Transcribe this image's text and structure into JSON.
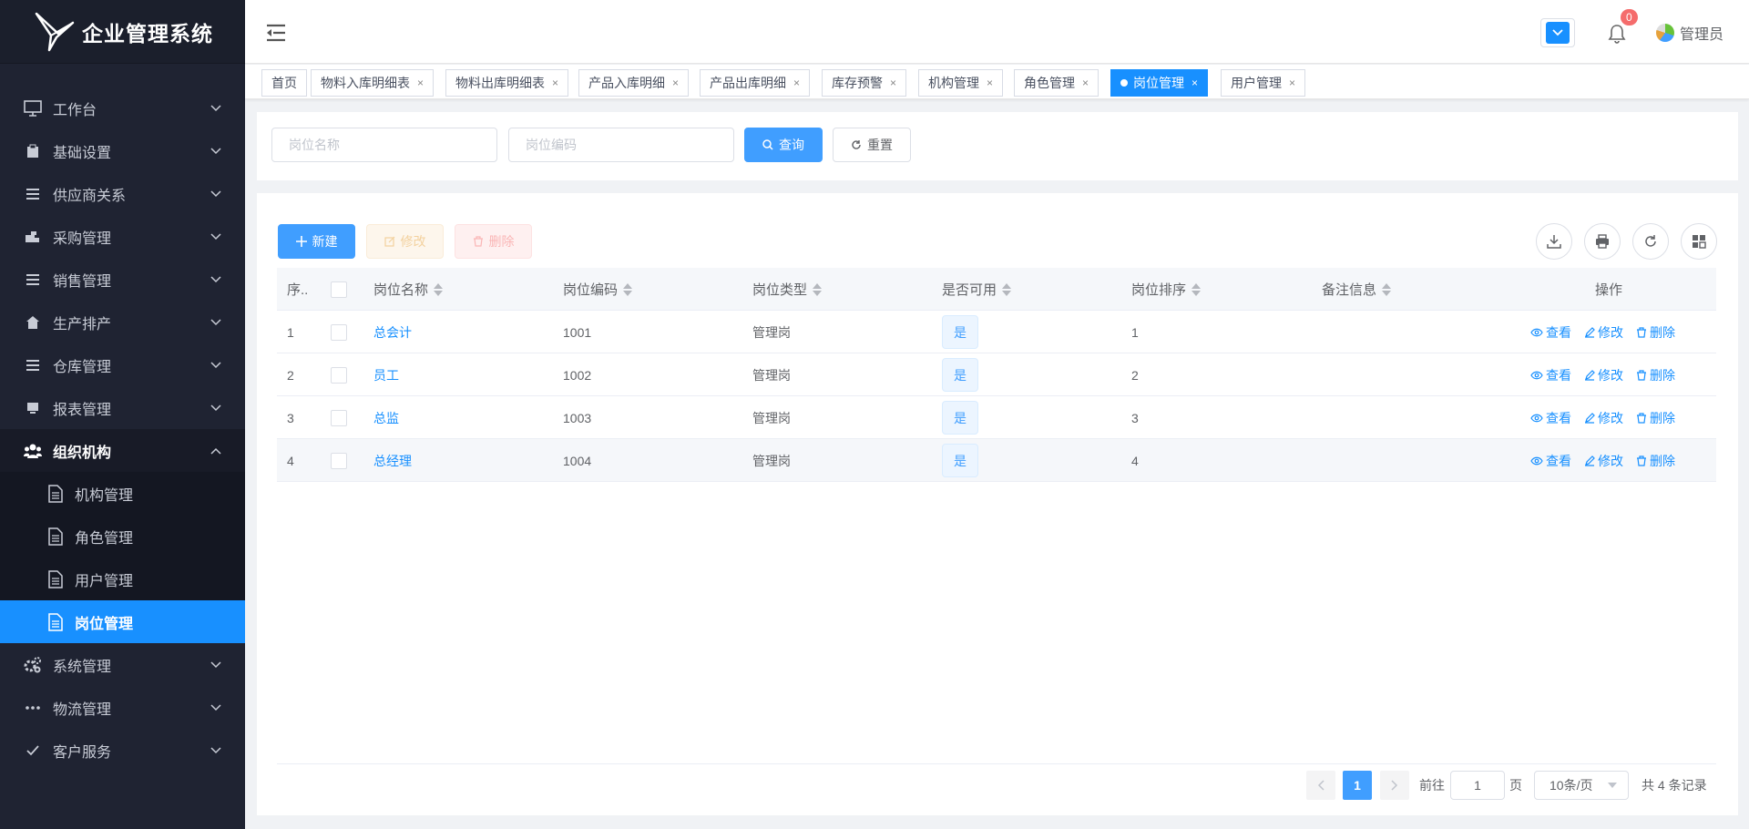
{
  "app": {
    "title": "企业管理系统"
  },
  "sidebar": {
    "items": [
      {
        "label": "工作台",
        "icon": "monitor-icon"
      },
      {
        "label": "基础设置",
        "icon": "clipboard-icon"
      },
      {
        "label": "供应商关系",
        "icon": "list-icon"
      },
      {
        "label": "采购管理",
        "icon": "truck-icon"
      },
      {
        "label": "销售管理",
        "icon": "list-icon"
      },
      {
        "label": "生产排产",
        "icon": "home-icon"
      },
      {
        "label": "仓库管理",
        "icon": "list-icon"
      },
      {
        "label": "报表管理",
        "icon": "screen-icon"
      },
      {
        "label": "组织机构",
        "icon": "users-icon"
      },
      {
        "label": "系统管理",
        "icon": "gears-icon"
      },
      {
        "label": "物流管理",
        "icon": "dots-icon"
      },
      {
        "label": "客户服务",
        "icon": "check-icon"
      }
    ],
    "sub_items": [
      {
        "label": "机构管理"
      },
      {
        "label": "角色管理"
      },
      {
        "label": "用户管理"
      },
      {
        "label": "岗位管理"
      }
    ]
  },
  "header": {
    "badge_count": "0",
    "user_name": "管理员",
    "accent": "#1890ff"
  },
  "tabs": [
    {
      "label": "首页"
    },
    {
      "label": "物料入库明细表"
    },
    {
      "label": "物料出库明细表"
    },
    {
      "label": "产品入库明细"
    },
    {
      "label": "产品出库明细"
    },
    {
      "label": "库存预警"
    },
    {
      "label": "机构管理"
    },
    {
      "label": "角色管理"
    },
    {
      "label": "岗位管理"
    },
    {
      "label": "用户管理"
    }
  ],
  "search": {
    "name_placeholder": "岗位名称",
    "code_placeholder": "岗位编码",
    "query_label": "查询",
    "reset_label": "重置"
  },
  "toolbar": {
    "new_label": "新建",
    "edit_label": "修改",
    "delete_label": "删除"
  },
  "table": {
    "headers": {
      "index": "序..",
      "name": "岗位名称",
      "code": "岗位编码",
      "type": "岗位类型",
      "enabled": "是否可用",
      "sort": "岗位排序",
      "remark": "备注信息",
      "ops": "操作"
    },
    "rows": [
      {
        "index": "1",
        "name": "总会计",
        "code": "1001",
        "type": "管理岗",
        "enabled": "是",
        "sort": "1",
        "remark": ""
      },
      {
        "index": "2",
        "name": "员工",
        "code": "1002",
        "type": "管理岗",
        "enabled": "是",
        "sort": "2",
        "remark": ""
      },
      {
        "index": "3",
        "name": "总监",
        "code": "1003",
        "type": "管理岗",
        "enabled": "是",
        "sort": "3",
        "remark": ""
      },
      {
        "index": "4",
        "name": "总经理",
        "code": "1004",
        "type": "管理岗",
        "enabled": "是",
        "sort": "4",
        "remark": ""
      }
    ],
    "ops": {
      "view": "查看",
      "edit": "修改",
      "delete": "删除"
    }
  },
  "pagination": {
    "current_page": "1",
    "goto_prefix": "前往",
    "goto_value": "1",
    "goto_suffix": "页",
    "page_size": "10条/页",
    "total": "共 4 条记录"
  }
}
